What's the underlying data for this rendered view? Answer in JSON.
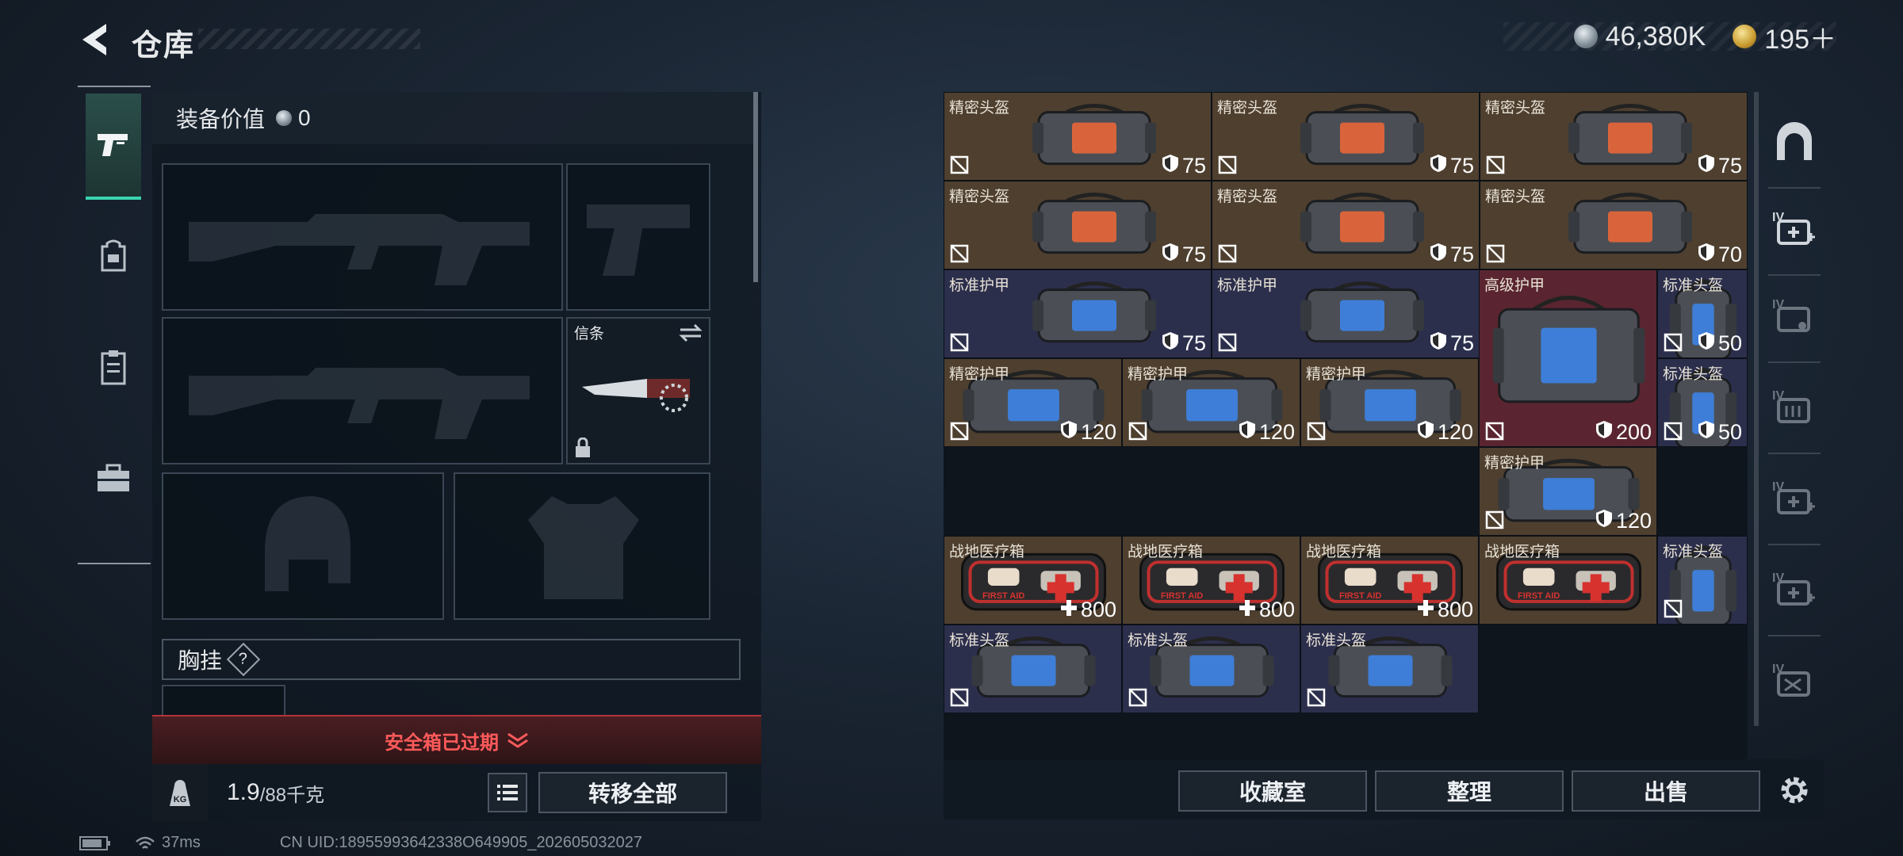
{
  "header": {
    "title": "仓库",
    "currency_main": "46,380K",
    "currency_premium": "195＋"
  },
  "loadout": {
    "value_label": "装备价值",
    "value": "0",
    "token_slot_label": "信条",
    "chest_rig_label": "胸挂",
    "help_mark": "?",
    "safe_box_status": "安全箱已过期",
    "weight_current": "1.9",
    "weight_capacity": "/88千克",
    "weight_badge": "KG",
    "transfer_all_label": "转移全部"
  },
  "inventory": {
    "items": [
      {
        "name": "精密头盔",
        "value": "75",
        "type": "shield",
        "tone": "brown",
        "icon": "duffel-bag-orange-icon"
      },
      {
        "name": "精密头盔",
        "value": "75",
        "type": "shield",
        "tone": "brown",
        "icon": "duffel-bag-orange-icon"
      },
      {
        "name": "精密头盔",
        "value": "75",
        "type": "shield",
        "tone": "brown",
        "icon": "duffel-bag-orange-icon"
      },
      {
        "name": "精密头盔",
        "value": "75",
        "type": "shield",
        "tone": "brown",
        "icon": "duffel-bag-orange-icon"
      },
      {
        "name": "精密头盔",
        "value": "75",
        "type": "shield",
        "tone": "brown",
        "icon": "duffel-bag-orange-icon"
      },
      {
        "name": "精密头盔",
        "value": "70",
        "type": "shield",
        "tone": "brown",
        "icon": "duffel-bag-orange-icon"
      },
      {
        "name": "标准护甲",
        "value": "75",
        "type": "shield",
        "tone": "blue",
        "icon": "duffel-bag-blue-icon"
      },
      {
        "name": "标准护甲",
        "value": "75",
        "type": "shield",
        "tone": "blue",
        "icon": "duffel-bag-blue-icon"
      },
      {
        "name": "高级护甲",
        "value": "200",
        "type": "shield",
        "tone": "red",
        "icon": "armor-bag-large-icon"
      },
      {
        "name": "标准头盔",
        "value": "50",
        "type": "shield",
        "tone": "blue",
        "icon": "tall-bag-icon"
      },
      {
        "name": "精密护甲",
        "value": "120",
        "type": "shield",
        "tone": "brown",
        "icon": "armor-bag-icon"
      },
      {
        "name": "精密护甲",
        "value": "120",
        "type": "shield",
        "tone": "brown",
        "icon": "armor-bag-icon"
      },
      {
        "name": "精密护甲",
        "value": "120",
        "type": "shield",
        "tone": "brown",
        "icon": "armor-bag-icon"
      },
      {
        "name": "精密护甲",
        "value": "120",
        "type": "shield",
        "tone": "brown",
        "icon": "armor-bag-icon"
      },
      {
        "name": "标准头盔",
        "value": "50",
        "type": "shield",
        "tone": "blue",
        "icon": "tall-bag-icon"
      },
      {
        "name": "战地医疗箱",
        "value": "800",
        "type": "heal",
        "tone": "brown",
        "icon": "first-aid-kit-icon",
        "kit_text": "FIRST AID"
      },
      {
        "name": "战地医疗箱",
        "value": "800",
        "type": "heal",
        "tone": "brown",
        "icon": "first-aid-kit-icon",
        "kit_text": "FIRST AID"
      },
      {
        "name": "战地医疗箱",
        "value": "800",
        "type": "heal",
        "tone": "brown",
        "icon": "first-aid-kit-icon",
        "kit_text": "FIRST AID"
      },
      {
        "name": "战地医疗箱",
        "value": "",
        "type": "heal",
        "tone": "brown",
        "icon": "first-aid-kit-icon",
        "kit_text": "FIRST AID"
      },
      {
        "name": "标准头盔",
        "value": "",
        "type": "shield",
        "tone": "blue",
        "icon": "tall-bag-icon"
      },
      {
        "name": "标准头盔",
        "value": "",
        "type": "shield",
        "tone": "blue",
        "icon": "duffel-bag-blue-icon"
      },
      {
        "name": "标准头盔",
        "value": "",
        "type": "shield",
        "tone": "blue",
        "icon": "duffel-bag-blue-icon"
      },
      {
        "name": "标准头盔",
        "value": "",
        "type": "shield",
        "tone": "blue",
        "icon": "duffel-bag-blue-icon"
      }
    ]
  },
  "bottom_actions": {
    "collection_label": "收藏室",
    "organize_label": "整理",
    "sell_label": "出售"
  },
  "right_rail": {
    "tabs": [
      {
        "icon": "vault-arch-icon",
        "tier": ""
      },
      {
        "icon": "add-case-icon",
        "tier": "IV"
      },
      {
        "icon": "case-icon",
        "tier": "IV"
      },
      {
        "icon": "folder-case-icon",
        "tier": "IV"
      },
      {
        "icon": "add-case-icon",
        "tier": "IV"
      },
      {
        "icon": "add-case-icon",
        "tier": "IV"
      },
      {
        "icon": "frame-case-icon",
        "tier": "IV"
      }
    ]
  },
  "status_bar": {
    "ping": "37ms",
    "uid": "CN UID:18955993642338O649905_202605032027"
  },
  "colors": {
    "accent_teal": "#38d6b0",
    "expired_red": "#ff5a5a",
    "cell_brown": "#4e3f2f",
    "cell_blue": "#2c2f4c",
    "cell_red": "#5a2530"
  }
}
